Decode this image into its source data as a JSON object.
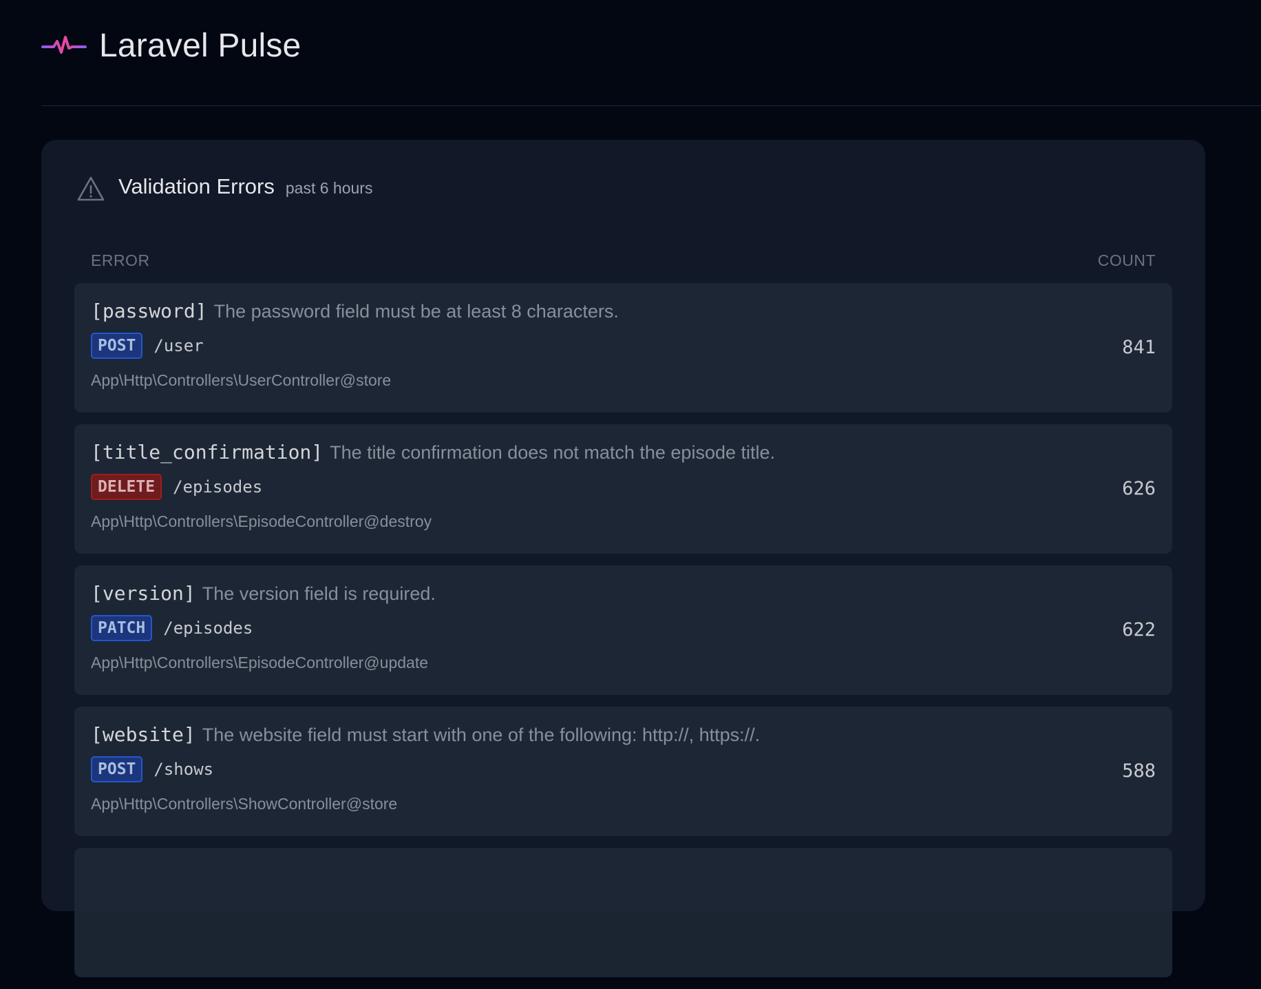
{
  "app": {
    "title": "Laravel Pulse",
    "logo_icon": "pulse-wave-icon"
  },
  "card": {
    "icon": "warning-triangle-icon",
    "title": "Validation Errors",
    "subtitle": "past 6 hours",
    "columns": {
      "error": "ERROR",
      "count": "COUNT"
    },
    "rows": [
      {
        "field": "[password]",
        "message": "The password field must be at least 8 characters.",
        "method": "POST",
        "path": "/user",
        "controller": "App\\Http\\Controllers\\UserController@store",
        "count": "841"
      },
      {
        "field": "[title_confirmation]",
        "message": "The title confirmation does not match the episode title.",
        "method": "DELETE",
        "path": "/episodes",
        "controller": "App\\Http\\Controllers\\EpisodeController@destroy",
        "count": "626"
      },
      {
        "field": "[version]",
        "message": "The version field is required.",
        "method": "PATCH",
        "path": "/episodes",
        "controller": "App\\Http\\Controllers\\EpisodeController@update",
        "count": "622"
      },
      {
        "field": "[website]",
        "message": "The website field must start with one of the following: http://, https://.",
        "method": "POST",
        "path": "/shows",
        "controller": "App\\Http\\Controllers\\ShowController@store",
        "count": "588"
      }
    ]
  },
  "colors": {
    "background": "#030712",
    "card": "#111827",
    "row": "#1f2937",
    "method_blue": "#1e3a8a",
    "method_red": "#7f1d1d",
    "logo_gradient_start": "#a855f7",
    "logo_gradient_end": "#ec4899"
  }
}
